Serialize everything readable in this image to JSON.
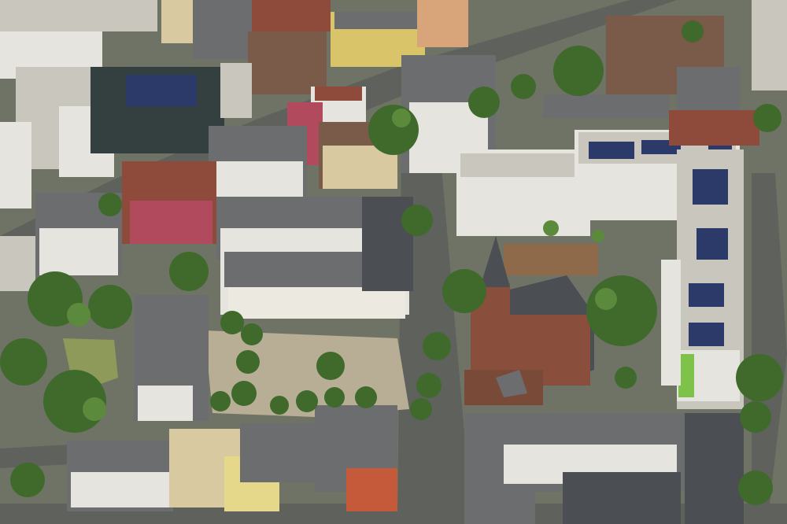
{
  "scene": {
    "subject": "aerial-city-block-with-church",
    "colors": {
      "ground": "#6f7365",
      "road": "#5f615c",
      "plaza": "#b8ae95",
      "tree": "#3f6a2c",
      "tree_light": "#5b8a3c",
      "grass": "#8e9a5a",
      "roof_gray": "#6b6d6e",
      "roof_dark": "#4b4e52",
      "roof_brown": "#7a5a48",
      "roof_red": "#8e4a3a",
      "roof_light": "#c9c6bd",
      "facade_white": "#e6e4de",
      "facade_cream": "#d8c9a0",
      "facade_yellow": "#d9c46a",
      "facade_pink": "#b04a5c",
      "facade_dark": "#33403f",
      "brick": "#8a4f3c",
      "solar": "#2c3a6a",
      "green_accent": "#7fc24a"
    }
  }
}
